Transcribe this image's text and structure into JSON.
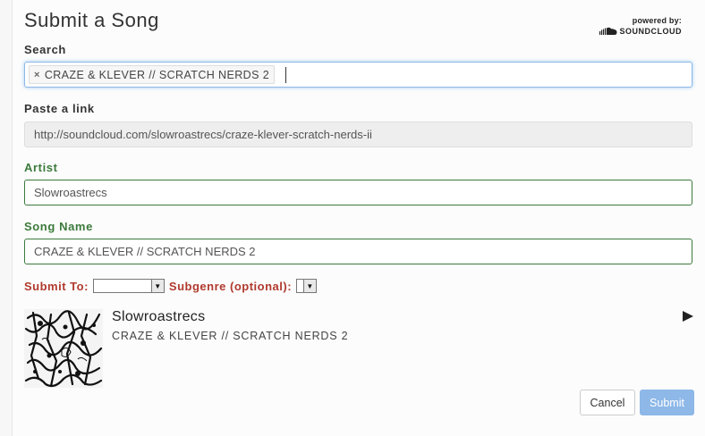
{
  "header": {
    "title": "Submit a Song",
    "powered_by": "powered by:",
    "brand": "SOUNDCLOUD"
  },
  "search": {
    "label": "Search",
    "token_remove_icon": "×",
    "token": "CRAZE & KLEVER // SCRATCH NERDS 2"
  },
  "link": {
    "label": "Paste a link",
    "value": "http://soundcloud.com/slowroastrecs/craze-klever-scratch-nerds-ii"
  },
  "artist": {
    "label": "Artist",
    "value": "Slowroastrecs"
  },
  "song_name": {
    "label": "Song Name",
    "value": "CRAZE & KLEVER // SCRATCH NERDS 2"
  },
  "submit_to": {
    "label": "Submit To:",
    "value": "",
    "subgenre_label": "Subgenre (optional):",
    "subgenre_value": ""
  },
  "track": {
    "artist": "Slowroastrecs",
    "title": "CRAZE & KLEVER // SCRATCH NERDS 2",
    "play_icon": "play-icon",
    "artwork_icon": "album-artwork"
  },
  "buttons": {
    "cancel": "Cancel",
    "submit": "Submit"
  },
  "colors": {
    "label_green": "#3c7a3c",
    "label_red": "#b03a2e",
    "submit_blue": "#8db8e8",
    "focus_blue": "#8fb8e6"
  }
}
